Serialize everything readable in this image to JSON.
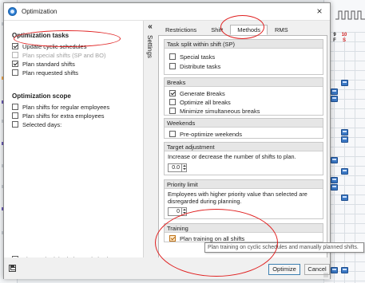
{
  "dialog": {
    "title": "Optimization",
    "close_glyph": "×",
    "collapse_glyph": "«",
    "sidebar_label": "Settings"
  },
  "left": {
    "tasks_title": "Optimization tasks",
    "tasks": [
      {
        "label": "Update cyclic schedules",
        "checked": true,
        "enabled": true
      },
      {
        "label": "Plan special shifts (SP and BO)",
        "checked": false,
        "enabled": false
      },
      {
        "label": "Plan standard shifts",
        "checked": true,
        "enabled": true
      },
      {
        "label": "Plan requested shifts",
        "checked": false,
        "enabled": true
      }
    ],
    "scope_title": "Optimization scope",
    "scope": [
      {
        "label": "Plan shifts for regular employees",
        "checked": false
      },
      {
        "label": "Plan shifts for extra employees",
        "checked": false
      },
      {
        "label": "Selected days:",
        "checked": false
      }
    ],
    "show_schedule": {
      "label": "Show schedule during optimization",
      "checked": true
    }
  },
  "tabs": [
    {
      "label": "Restrictions",
      "active": false
    },
    {
      "label": "Shift",
      "active": false
    },
    {
      "label": "Methods",
      "active": true
    },
    {
      "label": "RMS",
      "active": false
    }
  ],
  "groups": {
    "task_split": {
      "header": "Task split within shift (SP)",
      "items": [
        {
          "label": "Special tasks",
          "checked": false
        },
        {
          "label": "Distribute tasks",
          "checked": false
        }
      ]
    },
    "breaks": {
      "header": "Breaks",
      "items": [
        {
          "label": "Generate Breaks",
          "checked": true
        },
        {
          "label": "Optimize all breaks",
          "checked": false
        },
        {
          "label": "Minimize simultaneous breaks",
          "checked": false
        }
      ]
    },
    "weekends": {
      "header": "Weekends",
      "items": [
        {
          "label": "Pre-optimize weekends",
          "checked": false
        }
      ]
    },
    "target": {
      "header": "Target adjustment",
      "description": "Increase or decrease the number of shifts to plan.",
      "value": "0.0"
    },
    "priority": {
      "header": "Priority limit",
      "description_line1": "Employees with higher priority value than selected are",
      "description_line2": "disregarded during planning.",
      "value": "0"
    },
    "training": {
      "header": "Training",
      "item": {
        "label": "Plan training on all shifts",
        "checked": true
      }
    }
  },
  "tooltip": "Plan training on cyclic schedules and manually planned shifts.",
  "footer": {
    "optimize_label": "Optimize",
    "cancel_label": "Cancel",
    "save_icon": "save-icon"
  },
  "background": {
    "day_numbers": [
      {
        "text": "9",
        "sub": "F",
        "color": "#1e1e1e"
      },
      {
        "text": "10",
        "sub": "S",
        "color": "#d42020"
      }
    ]
  },
  "colors": {
    "annotation": "#e02020",
    "accent": "#2d7fd3",
    "training_checkbox": "#c07418"
  }
}
